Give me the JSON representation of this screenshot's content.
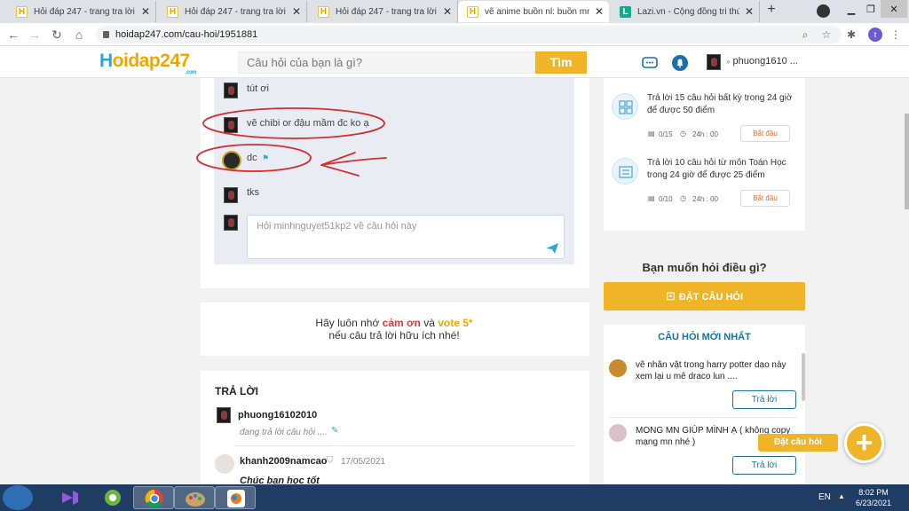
{
  "browser": {
    "tabs": [
      {
        "label": "Hỏi đáp 247 - trang tra lời",
        "favicon": "H"
      },
      {
        "label": "Hỏi đáp 247 - trang tra lời",
        "favicon": "H"
      },
      {
        "label": "Hỏi đáp 247 - trang tra lời",
        "favicon": "H"
      },
      {
        "label": "vẽ anime buồn nl: buồn mn cl",
        "favicon": "H"
      },
      {
        "label": "Lazi.vn - Cộng đồng tri thức &",
        "favicon": "L"
      }
    ],
    "close_glyph": "✕",
    "url": "hoidap247.com/cau-hoi/1951881",
    "profile_initial": "t"
  },
  "header": {
    "logo_h": "H",
    "logo_rest": "oidap247",
    "logo_com": ".com",
    "search_placeholder": "Câu hỏi của bạn là gì?",
    "search_button": "Tìm",
    "username": "phuong1610 ..."
  },
  "comments": [
    {
      "text": "tút ơi"
    },
    {
      "text": "vẽ chibi or đậu mầm đc ko ạ"
    },
    {
      "text": "dc"
    },
    {
      "text": "tks"
    }
  ],
  "reply_placeholder": "Hỏi minhnguyet51kp2 về câu hỏi này",
  "reminder": {
    "line1_pre": "Hãy luôn nhớ ",
    "thanks": "cảm ơn",
    "and": " và ",
    "vote": "vote 5*",
    "line2": "nếu câu trả lời hữu ích nhé!"
  },
  "answers": {
    "title": "TRẢ LỜI",
    "items": [
      {
        "user": "phuong16102010",
        "status": "đang trả lời câu hỏi ....",
        "date": "",
        "body": ""
      },
      {
        "user": "khanh2009namcao",
        "status": "",
        "date": "17/05/2021",
        "body": "Chúc bạn học tốt"
      }
    ]
  },
  "tasks": [
    {
      "text": "Trả lời 15 câu hỏi  bất kỳ  trong 24 giờ để được 50 điểm",
      "progress": "0/15",
      "time": "24h : 00",
      "button": "Bắt đầu"
    },
    {
      "text": "Trả lời 10 câu hỏi  từ môn Toán Học trong 24 giờ để được 25 điểm",
      "progress": "0/10",
      "time": "24h : 00",
      "button": "Bắt đầu"
    }
  ],
  "ask": {
    "title": "Bạn muốn hỏi điều gì?",
    "button": "ĐẶT CÂU HỎI"
  },
  "new_questions": {
    "title": "CÂU HỎI MỚI NHẤT",
    "items": [
      {
        "text": "vẽ nhân vật trong harry potter dạo này xem lại u mê draco lun ....",
        "button": "Trả lời"
      },
      {
        "text": "MONG MN GIÚP MÌNH Ạ ( không copy mạng mn nhé )",
        "button": "Trả lời"
      }
    ]
  },
  "fab": {
    "label": "Đặt câu hỏi",
    "icon": "+"
  },
  "taskbar": {
    "lang": "EN",
    "time": "8:02 PM",
    "date": "6/23/2021"
  },
  "colors": {
    "accent": "#f0b429",
    "brand_blue": "#2aa8d6",
    "link_blue": "#1d6fa5",
    "annotation_red": "#d32f2f"
  }
}
